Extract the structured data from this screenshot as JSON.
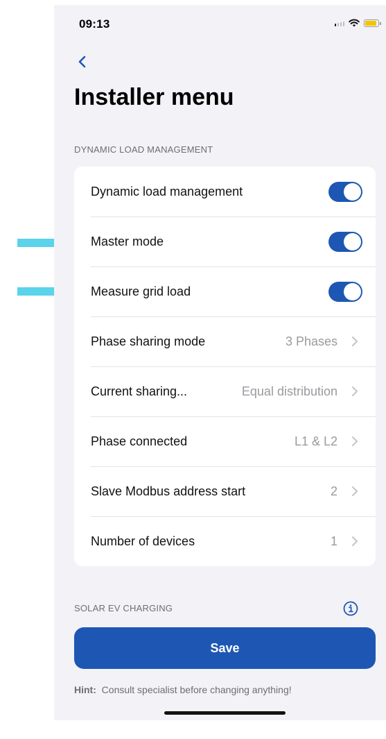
{
  "status_bar": {
    "time": "09:13"
  },
  "page": {
    "title": "Installer menu"
  },
  "sections": {
    "dynamic_load_management": {
      "header": "DYNAMIC LOAD MANAGEMENT",
      "rows": [
        {
          "label": "Dynamic load management",
          "type": "toggle",
          "on": true
        },
        {
          "label": "Master mode",
          "type": "toggle",
          "on": true
        },
        {
          "label": "Measure grid load",
          "type": "toggle",
          "on": true
        },
        {
          "label": "Phase sharing mode",
          "type": "value",
          "value": "3 Phases"
        },
        {
          "label": "Current sharing...",
          "type": "value",
          "value": "Equal distribution"
        },
        {
          "label": "Phase connected",
          "type": "value",
          "value": "L1 & L2"
        },
        {
          "label": "Slave Modbus address start",
          "type": "value",
          "value": "2"
        },
        {
          "label": "Number of devices",
          "type": "value",
          "value": "1"
        }
      ]
    },
    "solar_ev_charging": {
      "header": "SOLAR EV CHARGING"
    }
  },
  "actions": {
    "save_label": "Save"
  },
  "hint": {
    "label": "Hint:",
    "text": "Consult specialist before changing anything!"
  },
  "colors": {
    "accent": "#1d57b3",
    "annotation_arrow": "#5bd3ea",
    "background": "#f2f2f7"
  },
  "icons": [
    "back-chevron",
    "info-circle",
    "chevron-right",
    "wifi",
    "battery",
    "cellular-signal"
  ]
}
